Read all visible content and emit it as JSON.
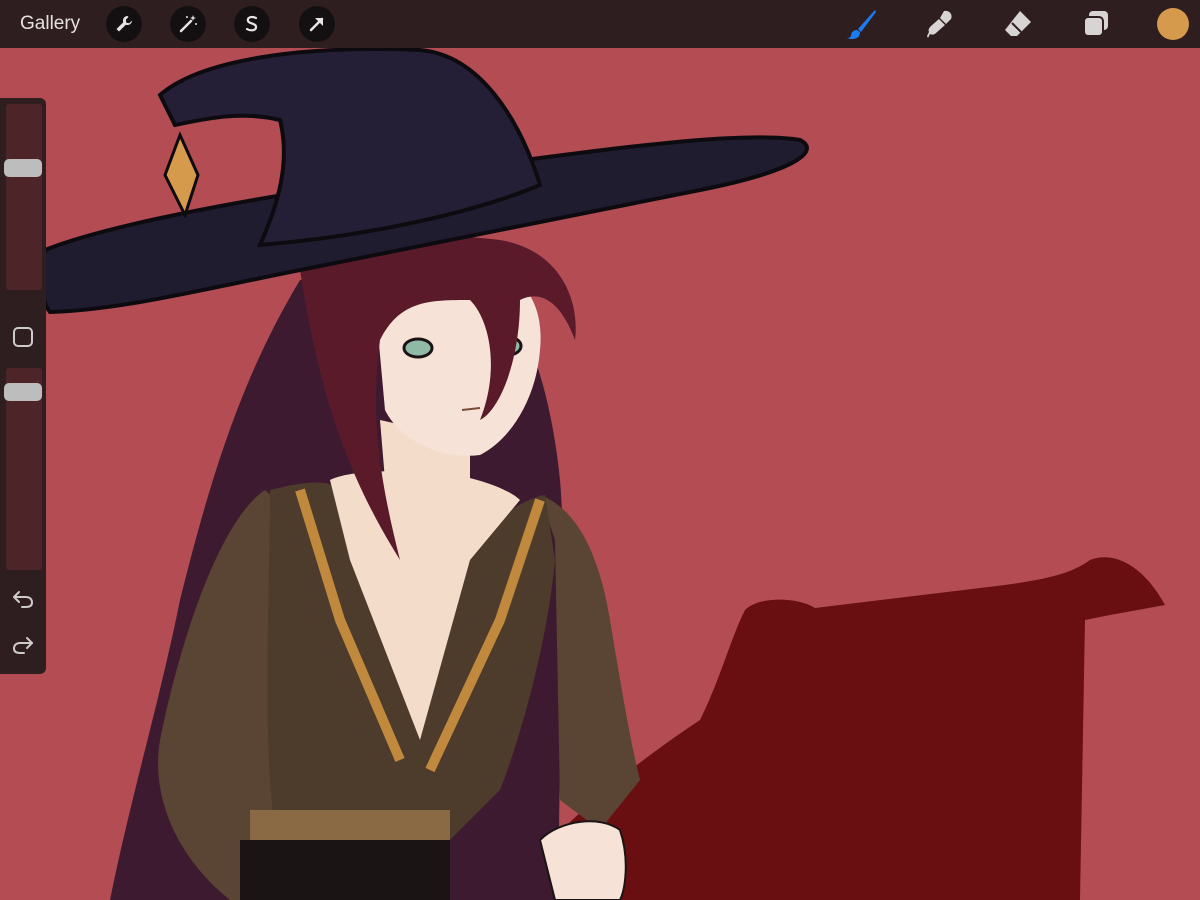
{
  "topbar": {
    "gallery_label": "Gallery",
    "left_tools": [
      {
        "name": "wrench-icon"
      },
      {
        "name": "magic-wand-icon"
      },
      {
        "name": "selection-s-icon"
      },
      {
        "name": "arrow-transform-icon"
      }
    ],
    "right_tools": [
      {
        "name": "brush-icon",
        "active_color": "#1e7cf2"
      },
      {
        "name": "smudge-icon"
      },
      {
        "name": "eraser-icon"
      },
      {
        "name": "layers-icon"
      }
    ],
    "current_color": "#d59a4b"
  },
  "sidebar": {
    "brush_size_level": 0.67,
    "opacity_level": 0.92,
    "modify_button": "square-modify-icon",
    "undo": "undo-icon",
    "redo": "redo-icon"
  },
  "canvas": {
    "background_color": "#b34d53",
    "shadow_color": "#6a0f11",
    "hat_color": "#201c30",
    "gem_color": "#d59a4b",
    "hair_color": "#4a1a2f",
    "skin_color": "#f4dccb",
    "top_color": "#4d3b2b",
    "trim_color": "#c0893d"
  }
}
